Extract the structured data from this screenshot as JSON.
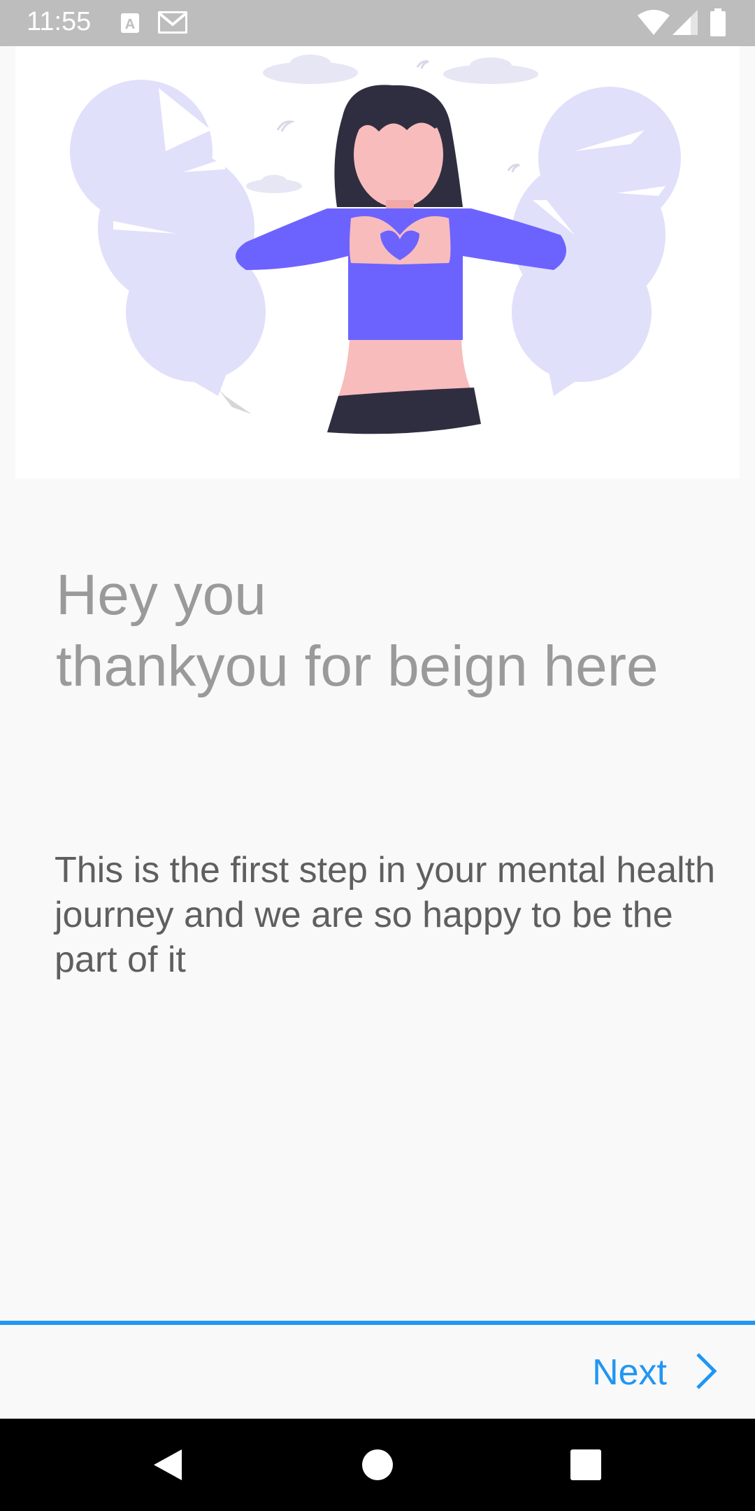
{
  "status_bar": {
    "time": "11:55",
    "icons": [
      "text-a-icon",
      "gmail-icon",
      "wifi-icon",
      "cell-signal-icon",
      "battery-icon"
    ]
  },
  "hero": {
    "illustration": "woman-heart-hands-illustration",
    "accent_color": "#6c63ff"
  },
  "onboarding": {
    "headline_line1": "Hey you",
    "headline_line2": "thankyou for beign here",
    "body": "This is the first step in your mental health journey and we are so happy to be the part of it"
  },
  "footer": {
    "next_label": "Next",
    "accent_color": "#2196f3"
  },
  "nav_bar": {
    "icons": [
      "back-icon",
      "home-icon",
      "recents-icon"
    ]
  }
}
